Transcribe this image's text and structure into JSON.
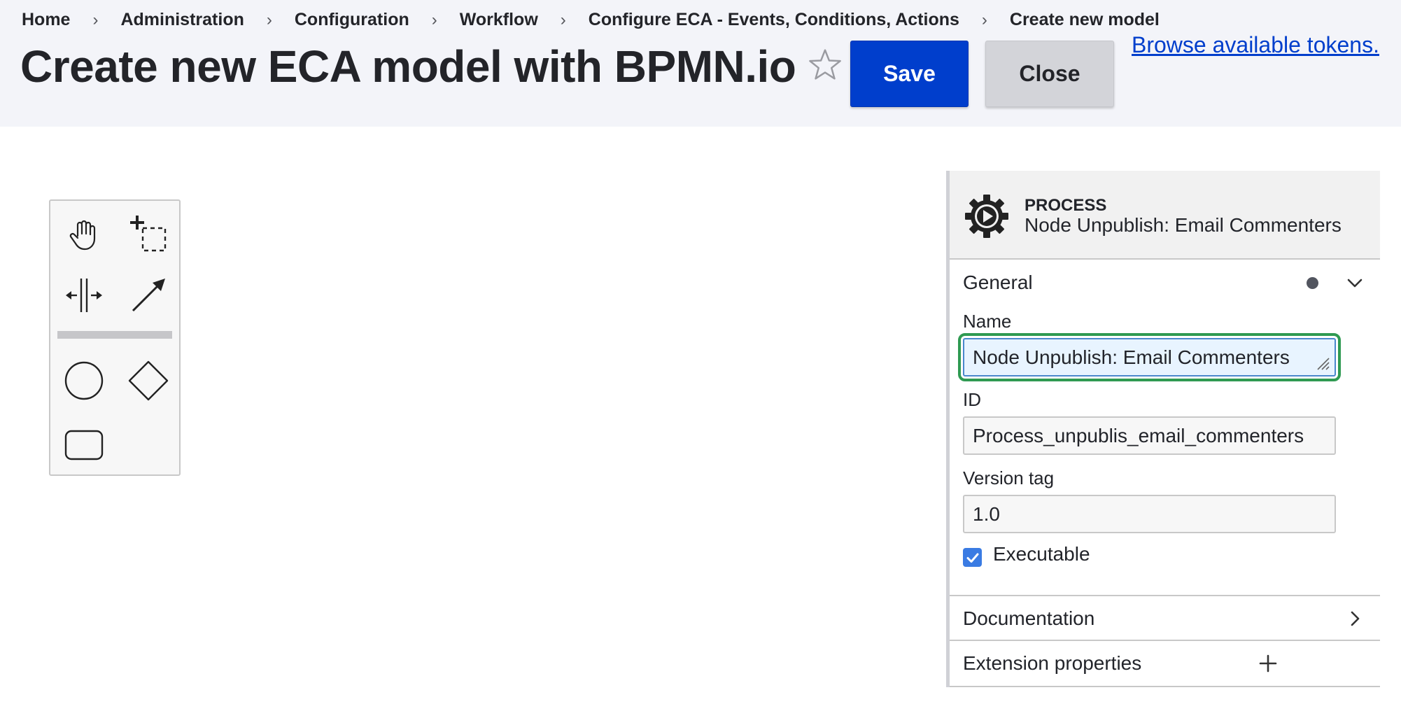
{
  "breadcrumb": {
    "items": [
      "Home",
      "Administration",
      "Configuration",
      "Workflow",
      "Configure ECA - Events, Conditions, Actions"
    ],
    "current": "Create new model",
    "separator": "›"
  },
  "page": {
    "title": "Create new ECA model with BPMN.io"
  },
  "actions": {
    "save_label": "Save",
    "close_label": "Close",
    "tokens_link": "Browse available tokens."
  },
  "palette": {
    "tools": [
      "hand-tool",
      "lasso-tool",
      "space-tool",
      "global-connect-tool",
      "create-start-event",
      "create-gateway",
      "create-task"
    ]
  },
  "properties": {
    "element_type": "PROCESS",
    "element_name": "Node Unpublish: Email Commenters",
    "general": {
      "title": "General",
      "name_label": "Name",
      "name_value": "Node Unpublish: Email Commenters",
      "id_label": "ID",
      "id_value": "Process_unpublis_email_commenters",
      "version_label": "Version tag",
      "version_value": "1.0",
      "executable_label": "Executable",
      "executable_checked": true
    },
    "documentation_title": "Documentation",
    "extension_title": "Extension properties"
  },
  "colors": {
    "primary_button": "#003ecc",
    "focus_outline": "#2f9a52",
    "checkbox": "#3a7be3"
  }
}
